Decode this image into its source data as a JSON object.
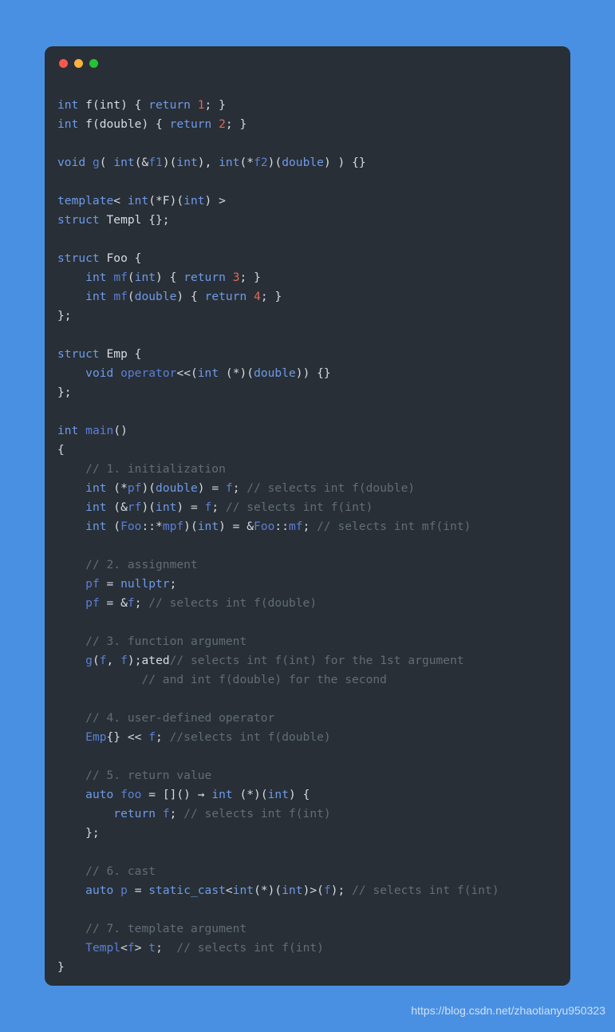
{
  "window": {
    "dots": [
      {
        "name": "close-dot",
        "color": "#f9574f"
      },
      {
        "name": "minimize-dot",
        "color": "#f9b23f"
      },
      {
        "name": "maximize-dot",
        "color": "#25c234"
      }
    ]
  },
  "theme": {
    "page_background": "#4a90e2",
    "card_background": "#282f36",
    "keyword": "#6f9ae8",
    "identifier": "#5b7fd4",
    "plain": "#d6dbe2",
    "number": "#e0685c",
    "comment": "#616d77"
  },
  "watermark": "https://blog.csdn.net/zhaotianyu950323",
  "code": {
    "language": "cpp",
    "plain_text": "int f(int) { return 1; }\nint f(double) { return 2; }\n\nvoid g( int(&f1)(int), int(*f2)(double) ) {}\n\ntemplate< int(*F)(int) >\nstruct Templ {};\n\nstruct Foo {\n    int mf(int) { return 3; }\n    int mf(double) { return 4; }\n};\n\nstruct Emp {\n    void operator<<(int (*)(double)) {}\n};\n\nint main()\n{\n    // 1. initialization\n    int (*pf)(double) = f; // selects int f(double)\n    int (&rf)(int) = f; // selects int f(int)\n    int (Foo::*mpf)(int) = &Foo::mf; // selects int mf(int)\n\n    // 2. assignment\n    pf = nullptr;\n    pf = &f; // selects int f(double)\n\n    // 3. function argument\n    g(f, f); // selects int f(int) for the 1st argument\n            // and int f(double) for the second\n\n    // 4. user-defined operator\n    Emp{} << f; //selects int f(double)\n\n    // 5. return value\n    auto foo = []() → int (*)(int) {\n        return f; // selects int f(int)\n    };\n\n    // 6. cast\n    auto p = static_cast<int(*)(int)>(f); // selects int f(int)\n\n    // 7. template argument\n    Templ<f> t;  // selects int f(int)\n}",
    "lines": [
      [
        [
          "kw",
          "int"
        ],
        [
          "plain",
          " "
        ],
        [
          "plain",
          "f(int) { "
        ],
        [
          "kw",
          "return"
        ],
        [
          "plain",
          " "
        ],
        [
          "num",
          "1"
        ],
        [
          "plain",
          "; }"
        ]
      ],
      [
        [
          "kw",
          "int"
        ],
        [
          "plain",
          " "
        ],
        [
          "plain",
          "f(double) { "
        ],
        [
          "kw",
          "return"
        ],
        [
          "plain",
          " "
        ],
        [
          "num",
          "2"
        ],
        [
          "plain",
          "; }"
        ]
      ],
      [],
      [
        [
          "kw",
          "void"
        ],
        [
          "plain",
          " "
        ],
        [
          "id",
          "g"
        ],
        [
          "plain",
          "( "
        ],
        [
          "kw",
          "int"
        ],
        [
          "plain",
          "(&"
        ],
        [
          "id",
          "f1"
        ],
        [
          "plain",
          ")("
        ],
        [
          "kw",
          "int"
        ],
        [
          "plain",
          "), "
        ],
        [
          "kw",
          "int"
        ],
        [
          "plain",
          "(*"
        ],
        [
          "id",
          "f2"
        ],
        [
          "plain",
          ")("
        ],
        [
          "kw",
          "double"
        ],
        [
          "plain",
          ") ) {}"
        ]
      ],
      [],
      [
        [
          "kw",
          "template"
        ],
        [
          "plain",
          "< "
        ],
        [
          "kw",
          "int"
        ],
        [
          "plain",
          "(*F)("
        ],
        [
          "kw",
          "int"
        ],
        [
          "plain",
          ") >"
        ]
      ],
      [
        [
          "kw",
          "struct"
        ],
        [
          "plain",
          " Templ {};"
        ]
      ],
      [],
      [
        [
          "kw",
          "struct"
        ],
        [
          "plain",
          " Foo {"
        ]
      ],
      [
        [
          "plain",
          "    "
        ],
        [
          "kw",
          "int"
        ],
        [
          "plain",
          " "
        ],
        [
          "id",
          "mf"
        ],
        [
          "plain",
          "("
        ],
        [
          "kw",
          "int"
        ],
        [
          "plain",
          ") { "
        ],
        [
          "kw",
          "return"
        ],
        [
          "plain",
          " "
        ],
        [
          "num",
          "3"
        ],
        [
          "plain",
          "; }"
        ]
      ],
      [
        [
          "plain",
          "    "
        ],
        [
          "kw",
          "int"
        ],
        [
          "plain",
          " "
        ],
        [
          "id",
          "mf"
        ],
        [
          "plain",
          "("
        ],
        [
          "kw",
          "double"
        ],
        [
          "plain",
          ") { "
        ],
        [
          "kw",
          "return"
        ],
        [
          "plain",
          " "
        ],
        [
          "num",
          "4"
        ],
        [
          "plain",
          "; }"
        ]
      ],
      [
        [
          "plain",
          "};"
        ]
      ],
      [],
      [
        [
          "kw",
          "struct"
        ],
        [
          "plain",
          " Emp {"
        ]
      ],
      [
        [
          "plain",
          "    "
        ],
        [
          "kw",
          "void"
        ],
        [
          "plain",
          " "
        ],
        [
          "id",
          "operator"
        ],
        [
          "plain",
          "<<("
        ],
        [
          "kw",
          "int"
        ],
        [
          "plain",
          " (*)("
        ],
        [
          "kw",
          "double"
        ],
        [
          "plain",
          ")) {}"
        ]
      ],
      [
        [
          "plain",
          "};"
        ]
      ],
      [],
      [
        [
          "kw",
          "int"
        ],
        [
          "plain",
          " "
        ],
        [
          "id",
          "main"
        ],
        [
          "plain",
          "()"
        ]
      ],
      [
        [
          "plain",
          "{"
        ]
      ],
      [
        [
          "plain",
          "    "
        ],
        [
          "cmt",
          "// 1. initialization"
        ]
      ],
      [
        [
          "plain",
          "    "
        ],
        [
          "kw",
          "int"
        ],
        [
          "plain",
          " (*"
        ],
        [
          "id",
          "pf"
        ],
        [
          "plain",
          ")("
        ],
        [
          "kw",
          "double"
        ],
        [
          "plain",
          ") = "
        ],
        [
          "id",
          "f"
        ],
        [
          "plain",
          "; "
        ],
        [
          "cmt",
          "// selects int f(double)"
        ]
      ],
      [
        [
          "plain",
          "    "
        ],
        [
          "kw",
          "int"
        ],
        [
          "plain",
          " (&"
        ],
        [
          "id",
          "rf"
        ],
        [
          "plain",
          ")("
        ],
        [
          "kw",
          "int"
        ],
        [
          "plain",
          ") = "
        ],
        [
          "id",
          "f"
        ],
        [
          "plain",
          "; "
        ],
        [
          "cmt",
          "// selects int f(int)"
        ]
      ],
      [
        [
          "plain",
          "    "
        ],
        [
          "kw",
          "int"
        ],
        [
          "plain",
          " ("
        ],
        [
          "id",
          "Foo"
        ],
        [
          "plain",
          "::*"
        ],
        [
          "id",
          "mpf"
        ],
        [
          "plain",
          ")("
        ],
        [
          "kw",
          "int"
        ],
        [
          "plain",
          ") = &"
        ],
        [
          "id",
          "Foo"
        ],
        [
          "plain",
          "::"
        ],
        [
          "id",
          "mf"
        ],
        [
          "plain",
          "; "
        ],
        [
          "cmt",
          "// selects int mf(int)"
        ]
      ],
      [],
      [
        [
          "plain",
          "    "
        ],
        [
          "cmt",
          "// 2. assignment"
        ]
      ],
      [
        [
          "plain",
          "    "
        ],
        [
          "id",
          "pf"
        ],
        [
          "plain",
          " = "
        ],
        [
          "kw",
          "nullptr"
        ],
        [
          "plain",
          ";"
        ]
      ],
      [
        [
          "plain",
          "    "
        ],
        [
          "id",
          "pf"
        ],
        [
          "plain",
          " = &"
        ],
        [
          "id",
          "f"
        ],
        [
          "plain",
          "; "
        ],
        [
          "cmt",
          "// selects int f(double)"
        ]
      ],
      [],
      [
        [
          "plain",
          "    "
        ],
        [
          "cmt",
          "// 3. function argument"
        ]
      ],
      [
        [
          "plain",
          "    "
        ],
        [
          "id",
          "g"
        ],
        [
          "plain",
          "("
        ],
        [
          "id",
          "f"
        ],
        [
          "plain",
          ", "
        ],
        [
          "id",
          "f"
        ],
        [
          "plain",
          ");ated"
        ],
        [
          "cmt",
          "// selects int f(int) for the 1st argument"
        ]
      ],
      [
        [
          "plain",
          "            "
        ],
        [
          "cmt",
          "// and int f(double) for the second"
        ]
      ],
      [],
      [
        [
          "plain",
          "    "
        ],
        [
          "cmt",
          "// 4. user-defined operator"
        ]
      ],
      [
        [
          "plain",
          "    "
        ],
        [
          "id",
          "Emp"
        ],
        [
          "plain",
          "{} << "
        ],
        [
          "id",
          "f"
        ],
        [
          "plain",
          "; "
        ],
        [
          "cmt",
          "//selects int f(double)"
        ]
      ],
      [],
      [
        [
          "plain",
          "    "
        ],
        [
          "cmt",
          "// 5. return value"
        ]
      ],
      [
        [
          "plain",
          "    "
        ],
        [
          "kw",
          "auto"
        ],
        [
          "plain",
          " "
        ],
        [
          "id",
          "foo"
        ],
        [
          "plain",
          " = []() → "
        ],
        [
          "kw",
          "int"
        ],
        [
          "plain",
          " (*)("
        ],
        [
          "kw",
          "int"
        ],
        [
          "plain",
          ") {"
        ]
      ],
      [
        [
          "plain",
          "        "
        ],
        [
          "kw",
          "return"
        ],
        [
          "plain",
          " "
        ],
        [
          "id",
          "f"
        ],
        [
          "plain",
          "; "
        ],
        [
          "cmt",
          "// selects int f(int)"
        ]
      ],
      [
        [
          "plain",
          "    };"
        ]
      ],
      [],
      [
        [
          "plain",
          "    "
        ],
        [
          "cmt",
          "// 6. cast"
        ]
      ],
      [
        [
          "plain",
          "    "
        ],
        [
          "kw",
          "auto"
        ],
        [
          "plain",
          " "
        ],
        [
          "id",
          "p"
        ],
        [
          "plain",
          " = "
        ],
        [
          "kw",
          "static_cast"
        ],
        [
          "plain",
          "<"
        ],
        [
          "kw",
          "int"
        ],
        [
          "plain",
          "(*)("
        ],
        [
          "kw",
          "int"
        ],
        [
          "plain",
          ")>("
        ],
        [
          "id",
          "f"
        ],
        [
          "plain",
          "); "
        ],
        [
          "cmt",
          "// selects int f(int)"
        ]
      ],
      [],
      [
        [
          "plain",
          "    "
        ],
        [
          "cmt",
          "// 7. template argument"
        ]
      ],
      [
        [
          "plain",
          "    "
        ],
        [
          "id",
          "Templ"
        ],
        [
          "plain",
          "<"
        ],
        [
          "id",
          "f"
        ],
        [
          "plain",
          "> "
        ],
        [
          "id",
          "t"
        ],
        [
          "plain",
          ";  "
        ],
        [
          "cmt",
          "// selects int f(int)"
        ]
      ],
      [
        [
          "plain",
          "}"
        ]
      ]
    ]
  }
}
